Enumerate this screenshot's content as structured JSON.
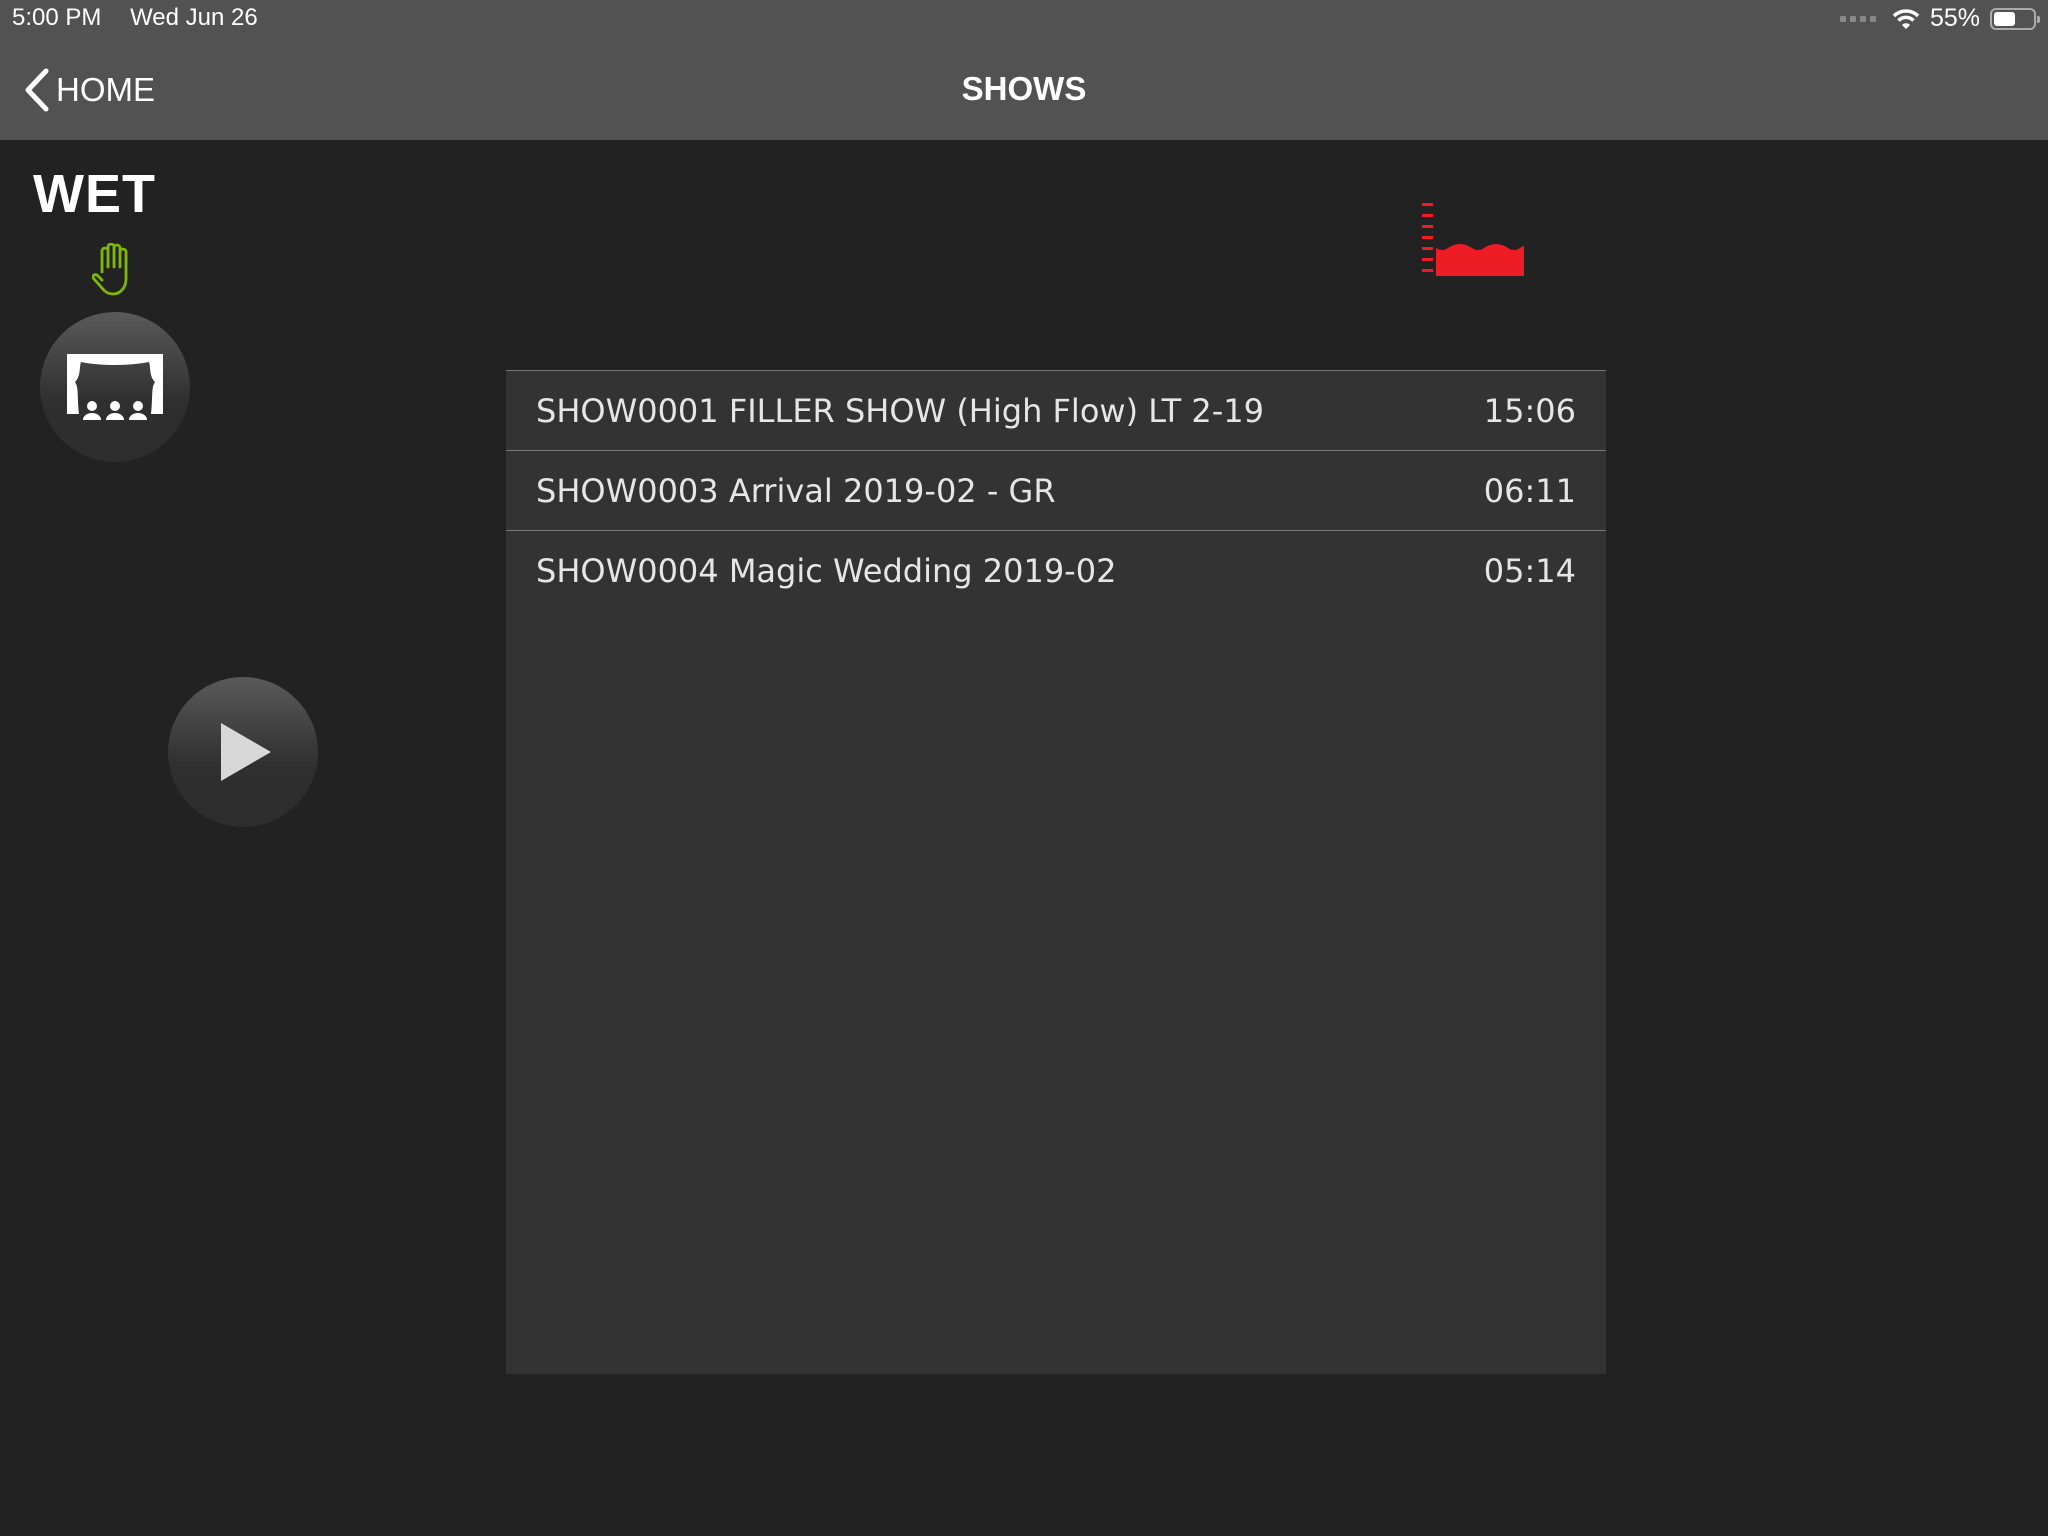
{
  "status_bar": {
    "time": "5:00 PM",
    "date": "Wed Jun 26",
    "battery": "55%",
    "battery_level": 0.55
  },
  "nav": {
    "back_label": "HOME",
    "title": "SHOWS"
  },
  "sidebar": {
    "mode_label": "WET",
    "hand_color": "#7fb800"
  },
  "indicator": {
    "icon": "water-level-icon",
    "color": "#ee1c24"
  },
  "shows": [
    {
      "name": "SHOW0001 FILLER SHOW (High Flow) LT 2-19",
      "duration": "15:06"
    },
    {
      "name": "SHOW0003 Arrival 2019-02 - GR",
      "duration": "06:11"
    },
    {
      "name": "SHOW0004 Magic Wedding 2019-02",
      "duration": "05:14"
    }
  ]
}
